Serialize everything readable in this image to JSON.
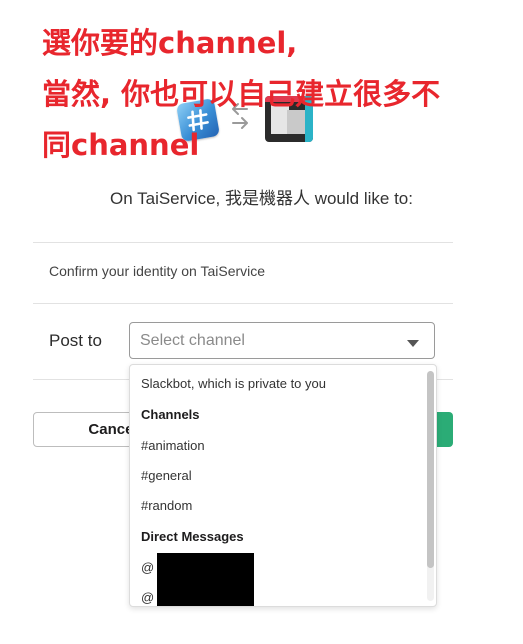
{
  "annotation": {
    "line1": "選你要的channel,",
    "line2": "當然, 你也可以自己建立很多不",
    "line3": "同channel",
    "color": "#e8262d"
  },
  "header": {
    "app_icon": "hashtag-app-icon",
    "exchange_icon": "swap-arrows-icon",
    "workspace_icon": "workspace-avatar",
    "request_text": "On TaiService, 我是機器人 would like to:"
  },
  "permissions": {
    "identity_text": "Confirm your identity on TaiService"
  },
  "post_to": {
    "label": "Post to",
    "placeholder": "Select channel",
    "value": ""
  },
  "dropdown": {
    "private_option": "Slackbot, which is private to you",
    "channels_header": "Channels",
    "channels": [
      "#animation",
      "#general",
      "#random"
    ],
    "dm_header": "Direct Messages",
    "direct_messages": [
      "@",
      "@"
    ]
  },
  "buttons": {
    "cancel_label": "Cancel",
    "authorize_color": "#2bac76"
  }
}
